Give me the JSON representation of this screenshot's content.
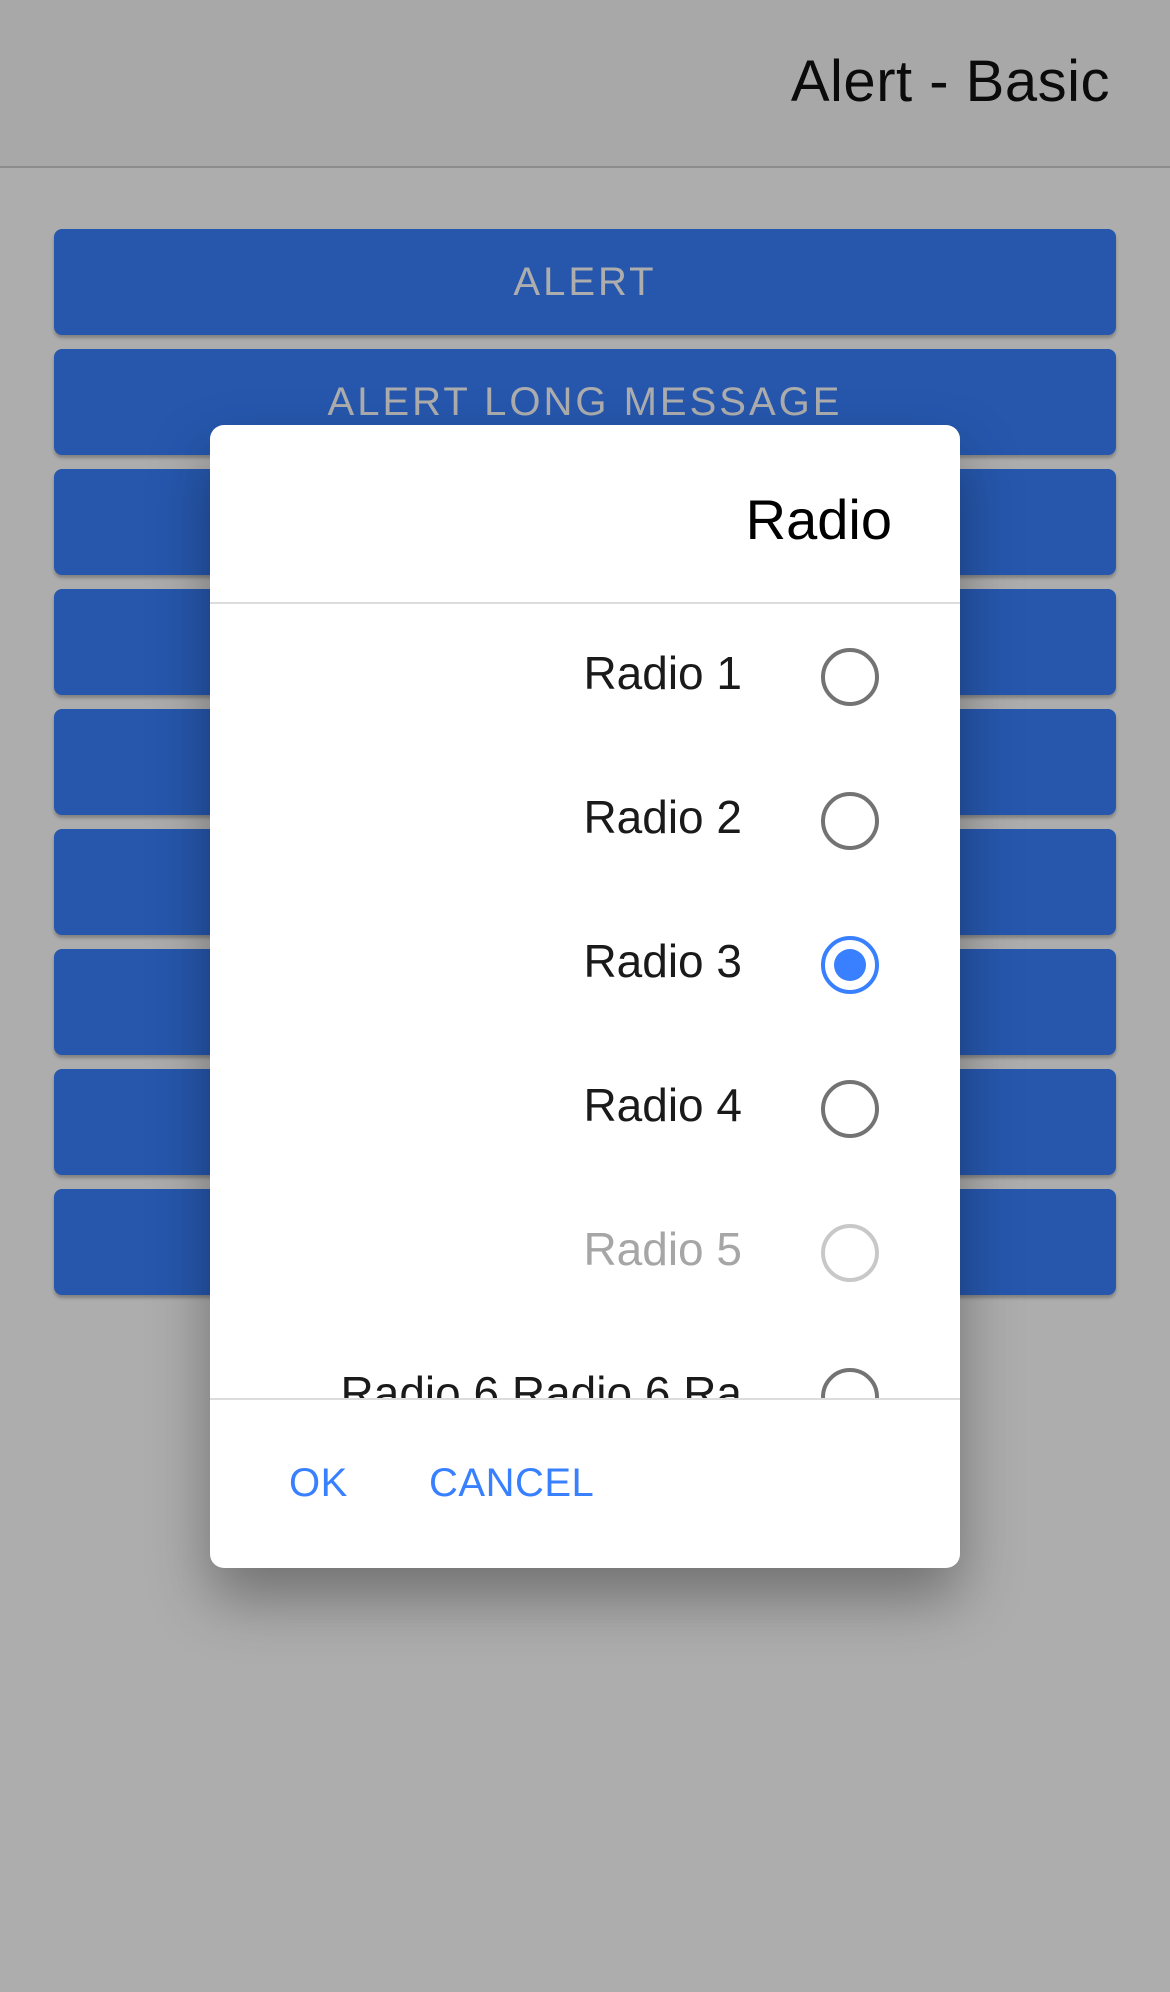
{
  "header": {
    "title": "Alert - Basic"
  },
  "buttons": [
    "ALERT",
    "ALERT LONG MESSAGE",
    "",
    "",
    "",
    "",
    "",
    "",
    ""
  ],
  "alert": {
    "title": "Radio",
    "options": [
      {
        "label": "Radio 1",
        "checked": false,
        "disabled": false
      },
      {
        "label": "Radio 2",
        "checked": false,
        "disabled": false
      },
      {
        "label": "Radio 3",
        "checked": true,
        "disabled": false
      },
      {
        "label": "Radio 4",
        "checked": false,
        "disabled": false
      },
      {
        "label": "Radio 5",
        "checked": false,
        "disabled": true
      },
      {
        "label": "Radio 6 Radio 6 Ra",
        "checked": false,
        "disabled": false
      }
    ],
    "ok_label": "OK",
    "cancel_label": "CANCEL"
  },
  "colors": {
    "primary": "#3880ff",
    "backdrop": "rgba(0,0,0,0.32)"
  }
}
